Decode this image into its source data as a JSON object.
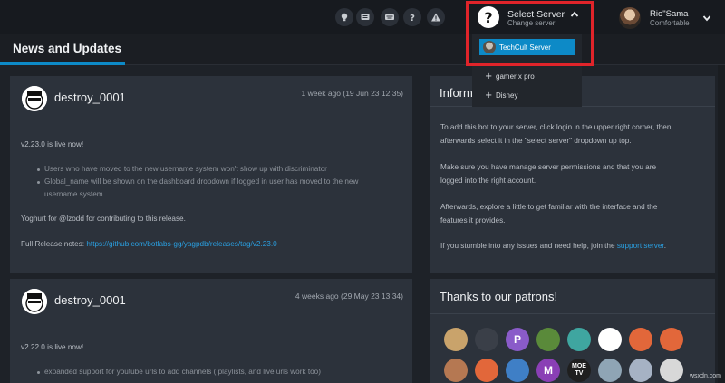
{
  "topbar": {
    "icons": [
      "lightbulb-icon",
      "chat-icon",
      "keyboard-icon",
      "help-icon",
      "warning-icon"
    ],
    "server_select": {
      "title": "Select Server",
      "subtitle": "Change server",
      "icon": "question-icon"
    },
    "user": {
      "name": "Rio\"Sama",
      "status": "Comfortable"
    }
  },
  "server_dropdown": {
    "items": [
      {
        "label": "TechCult Server",
        "selected": true
      },
      {
        "label": "gamer x pro",
        "prefix": "+"
      },
      {
        "label": "Disney",
        "prefix": "+"
      }
    ]
  },
  "header": {
    "title": "News and Updates"
  },
  "posts": [
    {
      "author": "destroy_0001",
      "date": "1 week ago (19 Jun 23 12:35)",
      "intro": "v2.23.0 is live now!",
      "bullets": [
        "Users who have moved to the new username system won't show up with discriminator",
        "Global_name will be shown on the dashboard dropdown if logged in user has moved to the new",
        "username system."
      ],
      "thanks": "Yoghurt for @lzodd for contributing to this release.",
      "release_label": "Full Release notes: ",
      "release_link": "https://github.com/botlabs-gg/yagpdb/releases/tag/v2.23.0"
    },
    {
      "author": "destroy_0001",
      "date": "4 weeks ago (29 May 23 13:34)",
      "intro": "v2.22.0 is live now!",
      "bullets": [
        "expanded support for youtube urls to add channels ( playlists, and live urls work too)"
      ]
    }
  ],
  "info_panel": {
    "title": "Inform",
    "paragraphs": [
      [
        "To add this bot to your server, click login in the upper right corner, then",
        "afterwards select it in the \"select server\" dropdown up top."
      ],
      [
        "Make sure you have manage server permissions and that you are",
        "logged into the right account."
      ],
      [
        "Afterwards, explore a little to get familiar with the interface and the",
        "features it provides."
      ]
    ],
    "help_text": "If you stumble into any issues and need help, join the ",
    "help_link": "support server",
    "help_end": "."
  },
  "patrons_panel": {
    "title": "Thanks to our patrons!",
    "patrons": [
      {
        "label": "",
        "color": "#c9a36b"
      },
      {
        "label": "",
        "color": "#3a3f48"
      },
      {
        "label": "P",
        "color": "#8a5bc9"
      },
      {
        "label": "",
        "color": "#5a8a3a"
      },
      {
        "label": "",
        "color": "#3fa6a0"
      },
      {
        "label": "",
        "color": "#ffffff"
      },
      {
        "label": "",
        "color": "#e2673a"
      },
      {
        "label": "",
        "color": "#e2673a"
      },
      {
        "label": "",
        "color": "#b57852"
      },
      {
        "label": "",
        "color": "#e2673a"
      },
      {
        "label": "",
        "color": "#3f7fc6"
      },
      {
        "label": "M",
        "color": "#8a3fb5"
      },
      {
        "label": "MOE TV",
        "color": "#1f1f1f"
      },
      {
        "label": "",
        "color": "#8fa5b5"
      },
      {
        "label": "",
        "color": "#a6b2c4"
      },
      {
        "label": "",
        "color": "#d8d8d8"
      }
    ]
  },
  "watermark": "wsxdn.com"
}
